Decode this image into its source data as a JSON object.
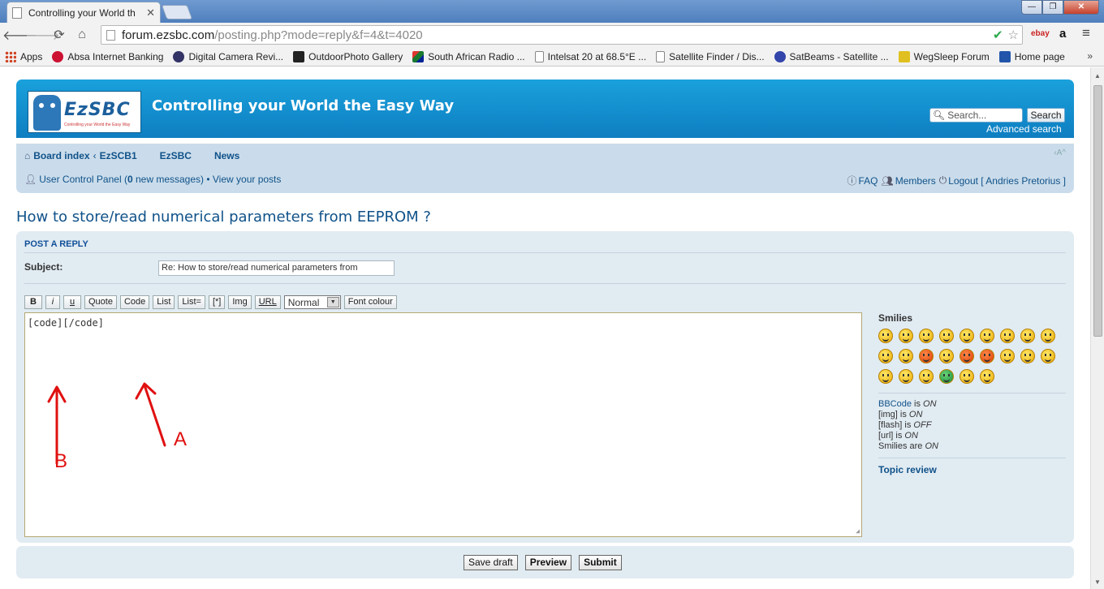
{
  "browser": {
    "tab_title": "Controlling your World th",
    "tab_close": "✕",
    "window_buttons": {
      "minimize": "—",
      "maximize": "❐",
      "close": "✕"
    },
    "url_host": "forum.ezsbc.com",
    "url_path": "/posting.php?mode=reply&f=4&t=4020",
    "extensions": [
      "ebay",
      "a",
      "≡"
    ],
    "bookmarks": [
      {
        "label": "Apps",
        "icon": "apps-grid-icon",
        "color": "#d04020"
      },
      {
        "label": "Absa Internet Banking",
        "icon": "absa-icon",
        "color": "#cc1133"
      },
      {
        "label": "Digital Camera Revi...",
        "icon": "camera-review-icon",
        "color": "#333366"
      },
      {
        "label": "OutdoorPhoto Gallery",
        "icon": "outdoorphoto-icon",
        "color": "#222222"
      },
      {
        "label": "South African Radio ...",
        "icon": "sa-flag-icon",
        "color": "#1a7a30"
      },
      {
        "label": "Intelsat 20 at 68.5°E ...",
        "icon": "page-icon",
        "color": "#ffffff"
      },
      {
        "label": "Satellite Finder / Dis...",
        "icon": "page-icon",
        "color": "#ffffff"
      },
      {
        "label": "SatBeams - Satellite ...",
        "icon": "satbeams-icon",
        "color": "#3344aa"
      },
      {
        "label": "WegSleep Forum",
        "icon": "wegsleep-icon",
        "color": "#e0c020"
      },
      {
        "label": "Home page",
        "icon": "homepage-icon",
        "color": "#2255aa"
      }
    ],
    "bookmarks_more": "»"
  },
  "site": {
    "logo_text": "EzSBC",
    "logo_tagline": "Controlling your World the Easy Way",
    "title": "Controlling your World the Easy Way",
    "search_placeholder": "Search...",
    "search_button": "Search",
    "advanced_search": "Advanced search"
  },
  "nav": {
    "breadcrumbs": [
      "Board index",
      "EzSCB1"
    ],
    "crumb_separator": "‹",
    "extra_links": [
      "EzSBC",
      "News"
    ],
    "font_size_control": "‹A^",
    "ucp_label": "User Control Panel (",
    "ucp_count": "0",
    "ucp_tail": " new messages) • ",
    "view_posts": "View your posts",
    "faq": "FAQ",
    "members": "Members",
    "logout": "Logout [ Andries Pretorius ]"
  },
  "topic": {
    "title": "How to store/read numerical parameters from EEPROM ?"
  },
  "post": {
    "panel_label": "POST A REPLY",
    "subject_label": "Subject:",
    "subject_value": "Re: How to store/read numerical parameters from",
    "bbcode_buttons": [
      "B",
      "i",
      "u",
      "Quote",
      "Code",
      "List",
      "List=",
      "[*]",
      "Img",
      "URL"
    ],
    "font_size_value": "Normal",
    "font_colour": "Font colour",
    "message": "[code][/code]"
  },
  "annotations": {
    "label_a": "A",
    "label_b": "B",
    "color": "#e01010"
  },
  "smilies": {
    "header": "Smilies",
    "count": 23,
    "bbcode_link": "BBCode",
    "bbcode_status": [
      {
        "pre": "",
        "link": "BBCode",
        "mid": " is ",
        "state": "ON"
      },
      {
        "pre": "[img]",
        "link": "",
        "mid": " is ",
        "state": "ON"
      },
      {
        "pre": "[flash]",
        "link": "",
        "mid": " is ",
        "state": "OFF"
      },
      {
        "pre": "[url]",
        "link": "",
        "mid": " is ",
        "state": "ON"
      },
      {
        "pre": "Smilies",
        "link": "",
        "mid": " are ",
        "state": "ON"
      }
    ],
    "topic_review": "Topic review"
  },
  "actions": {
    "save_draft": "Save draft",
    "preview": "Preview",
    "submit": "Submit"
  },
  "colors": {
    "banner": "#1aa1dc",
    "nav_bg": "#cadceb",
    "panel_bg": "#e1ebf2",
    "link": "#105289"
  }
}
